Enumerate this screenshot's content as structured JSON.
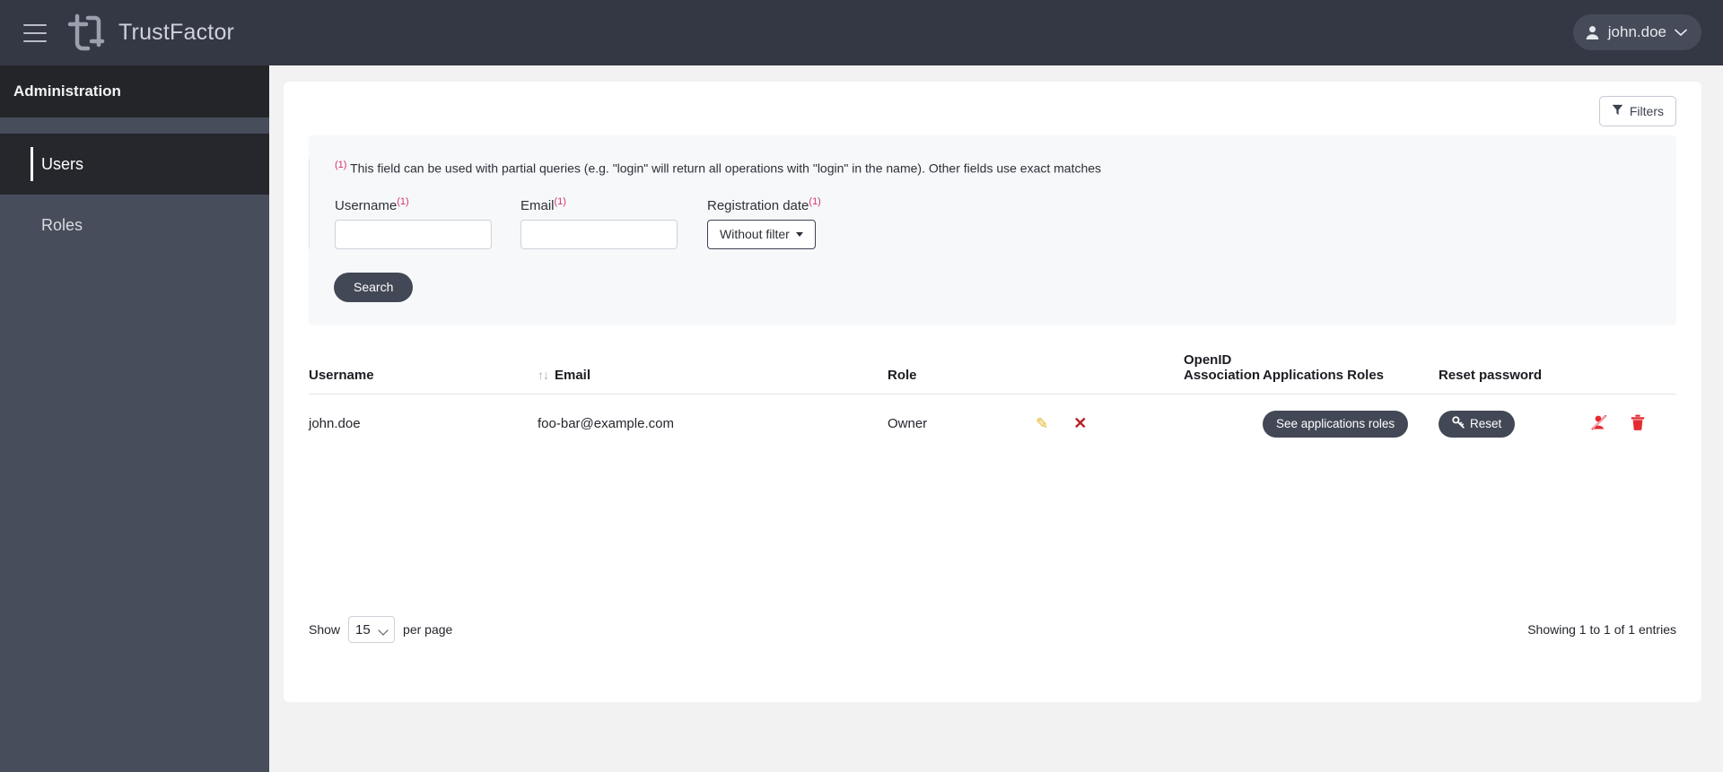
{
  "app": {
    "brand": "TrustFactor",
    "logo_icon": "trustfactor-logo-icon",
    "menu_icon": "hamburger-menu-icon"
  },
  "user_menu": {
    "name": "john.doe",
    "avatar_icon": "user-person-icon",
    "chevron_icon": "chevron-down-icon"
  },
  "sidebar": {
    "header": "Administration",
    "items": [
      {
        "label": "Users",
        "active": true
      },
      {
        "label": "Roles",
        "active": false
      }
    ]
  },
  "filters": {
    "toggle_label": "Filters",
    "toggle_icon": "funnel-filter-icon",
    "note_marker": "(1)",
    "note": "This field can be used with partial queries (e.g. \"login\" will return all operations with \"login\" in the name). Other fields use exact matches",
    "username": {
      "label": "Username",
      "marker": "(1)",
      "value": "",
      "placeholder": ""
    },
    "email": {
      "label": "Email",
      "marker": "(1)",
      "value": "",
      "placeholder": ""
    },
    "registration_date": {
      "label": "Registration date",
      "marker": "(1)",
      "selected": "Without filter",
      "caret_icon": "caret-down-icon"
    },
    "search_label": "Search"
  },
  "table": {
    "sort_icon": "sort-updown-icon",
    "columns": {
      "username": "Username",
      "email": "Email",
      "role": "Role",
      "openid_line1": "OpenID",
      "openid_line2": "Association",
      "applications_roles": "Applications Roles",
      "reset_password": "Reset password"
    },
    "rows": [
      {
        "username": "john.doe",
        "email": "foo-bar@example.com",
        "role": "Owner",
        "edit_icon": "pencil-edit-icon",
        "edit_glyph": "✎",
        "delete_role_icon": "x-cross-icon",
        "delete_role_glyph": "✕",
        "applications_roles_label": "See applications roles",
        "reset_label": "Reset",
        "reset_icon": "key-icon",
        "disable_user_icon": "user-slash-icon",
        "trash_icon": "trash-delete-icon"
      }
    ]
  },
  "footer": {
    "show_label": "Show",
    "per_page_value": "15",
    "per_page_options": [
      "15"
    ],
    "per_page_label": "per page",
    "entries_text": "Showing 1 to 1 of 1 entries"
  },
  "colors": {
    "topnav": "#343845",
    "sidebar": "#474d5a",
    "sidebar_dark": "#25272c",
    "accent_dark": "#434856",
    "marker_red": "#d6336c",
    "icon_red": "#e32b33",
    "pencil_gold": "#e6b422"
  }
}
